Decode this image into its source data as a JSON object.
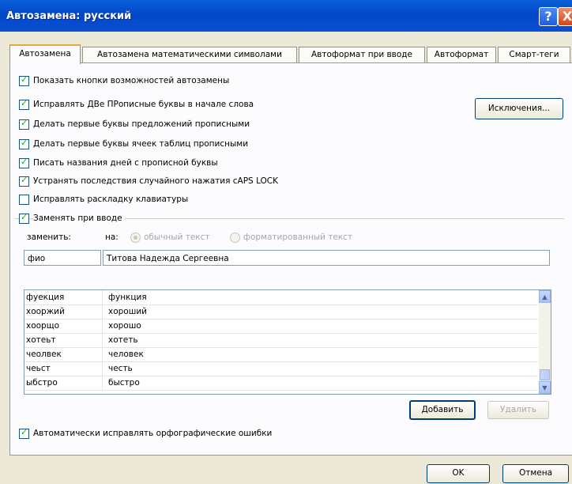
{
  "window": {
    "title": "Автозамена: русский",
    "help_label": "?",
    "close_label": "X"
  },
  "tabs": [
    {
      "label": "Автозамена",
      "active": true
    },
    {
      "label": "Автозамена математическими символами",
      "active": false
    },
    {
      "label": "Автоформат при вводе",
      "active": false
    },
    {
      "label": "Автоформат",
      "active": false
    },
    {
      "label": "Смарт-теги",
      "active": false
    }
  ],
  "options": {
    "show_buttons": {
      "label": "Показать кнопки возможностей автозамены",
      "checked": true
    },
    "two_caps": {
      "label": "Исправлять ДВе ПРописные буквы в начале слова",
      "checked": true
    },
    "first_sentence": {
      "label": "Делать первые буквы предложений прописными",
      "checked": true
    },
    "first_cell": {
      "label": "Делать первые буквы ячеек таблиц прописными",
      "checked": true
    },
    "day_names": {
      "label": "Писать названия дней с прописной буквы",
      "checked": true
    },
    "caps_lock": {
      "label": "Устранять последствия случайного нажатия cAPS LOCK",
      "checked": true
    },
    "keyboard_layout": {
      "label": "Исправлять раскладку клавиатуры",
      "checked": false
    },
    "replace_typing": {
      "label": "Заменять при вводе",
      "checked": true
    },
    "auto_spelling": {
      "label": "Автоматически исправлять орфографические ошибки",
      "checked": true
    }
  },
  "exceptions_button": "Исключения...",
  "replace": {
    "replace_label": "заменить:",
    "with_label": "на:",
    "plain_text": "обычный текст",
    "formatted_text": "форматированный текст",
    "replace_value": "фио",
    "with_value": "Титова Надежда Сергеевна"
  },
  "entries": [
    {
      "from": "фуекция",
      "to": "функция"
    },
    {
      "from": "хооржий",
      "to": "хороший"
    },
    {
      "from": "хоорщо",
      "to": "хорошо"
    },
    {
      "from": "хотеьт",
      "to": "хотеть"
    },
    {
      "from": "чеолвек",
      "to": "человек"
    },
    {
      "from": "чеьст",
      "to": "честь"
    },
    {
      "from": "ыбстро",
      "to": "быстро"
    }
  ],
  "buttons": {
    "add": "Добавить",
    "delete": "Удалить",
    "ok": "OK",
    "cancel": "Отмена"
  },
  "icons": {
    "check": "✓",
    "scroll_up": "▲",
    "scroll_down": "▼"
  }
}
